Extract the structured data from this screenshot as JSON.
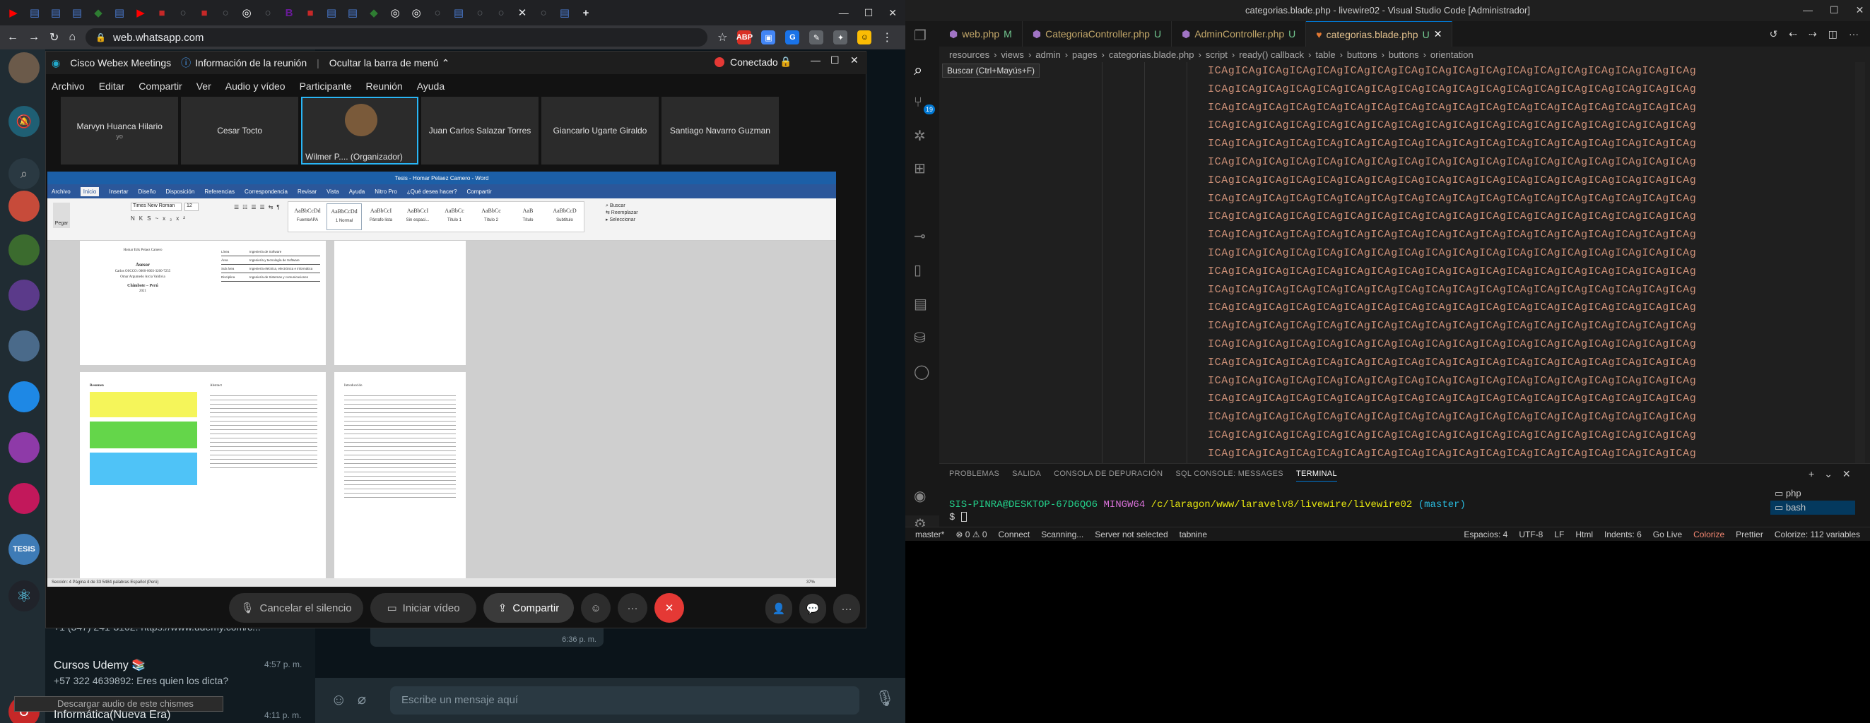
{
  "browser": {
    "url": "web.whatsapp.com",
    "tab_icons": [
      "youtube-icon",
      "page-icon",
      "page-icon",
      "page-icon",
      "green-icon",
      "page-icon",
      "youtube-icon",
      "red-icon",
      "circle-icon",
      "red-icon",
      "circle-icon",
      "github-icon",
      "circle-icon",
      "purple-icon",
      "red-icon",
      "page-icon",
      "page-icon",
      "green-icon",
      "github-icon",
      "github-icon",
      "circle-icon",
      "page-icon",
      "circle-icon",
      "circle-icon",
      "close-icon",
      "circle-icon",
      "page-icon",
      "add-icon"
    ]
  },
  "whatsapp": {
    "snippet_phone": "+1 (347) 241-3102: https://www.udemy.com/c...",
    "chat1_name": "Cursos Udemy 📚",
    "chat1_time": "4:57 p. m.",
    "chat1_msg": "+57 322 4639892: Eres quien los dicta?",
    "chat2_name": "Informática(Nueva Era)",
    "chat2_time": "4:11 p. m.",
    "download_toast": "Descargar audio de este chismes",
    "bubble_time": "6:36 p. m.",
    "composer_placeholder": "Escribe un mensaje aquí"
  },
  "webex": {
    "title": "Cisco Webex Meetings",
    "info": "Información de la reunión",
    "hide_menu": "Ocultar la barra de menú",
    "status": "Conectado",
    "menu": [
      "Archivo",
      "Editar",
      "Compartir",
      "Ver",
      "Audio y vídeo",
      "Participante",
      "Reunión",
      "Ayuda"
    ],
    "participants": [
      "Marvyn Huanca Hilario",
      "Cesar Tocto",
      "Wilmer P.... (Organizador)",
      "Juan Carlos Salazar Torres",
      "Giancarlo Ugarte Giraldo",
      "Santiago Navarro Guzman"
    ],
    "participant_sub": "yo",
    "mute": "Cancelar el silencio",
    "video": "Iniciar vídeo",
    "share": "Compartir",
    "word": {
      "title": "Tesis - Homar Pelaez Camero  -  Word",
      "tabs": [
        "Archivo",
        "Inicio",
        "Insertar",
        "Diseño",
        "Disposición",
        "Referencias",
        "Correspondencia",
        "Revisar",
        "Vista",
        "Ayuda",
        "Nitro Pro",
        "¿Qué desea hacer?",
        "Compartir"
      ],
      "font": "Times New Roman",
      "size": "12",
      "styles": [
        "AaBbCcDd",
        "AaBbCcDd",
        "AaBbCcI",
        "AaBbCcI",
        "AaBbCc",
        "AaBbCc",
        "AaB",
        "AaBbCcD"
      ],
      "style_names": [
        "FuenteAPA",
        "1 Normal",
        "Párrafo lista",
        "Sin espaci...",
        "Título 1",
        "Título 2",
        "Título",
        "Subtítulo"
      ],
      "page1": [
        "Homar Erik Pelaez Camero",
        "Asesor",
        "Carlos OSCCO: 0000-0003-3200-7255",
        "Omar Argumedo Arcia Valdivia",
        "Chimbote – Perú",
        "2021"
      ],
      "table_rows": [
        "Línea",
        "Área",
        "Sub área",
        "Disciplina"
      ],
      "table_vals": [
        "Ingeniería de Software",
        "Ingeniería y tecnología de Software",
        "Ingeniería eléctrica, electrónica e informática",
        "Ingeniería de Sistemas y comunicaciones"
      ],
      "p4_title": "Resumen",
      "p5_title": "Abstract",
      "p6_title": "Introducción",
      "status": "Sección: 4    Página 4 de 33    5484 palabras    Español (Perú)",
      "zoom": "37%"
    }
  },
  "vscode": {
    "title": "categorias.blade.php - livewire02 - Visual Studio Code [Administrador]",
    "tabs": [
      {
        "name": "web.php",
        "flag": "M"
      },
      {
        "name": "CategoriaController.php",
        "flag": "U"
      },
      {
        "name": "AdminController.php",
        "flag": "U"
      },
      {
        "name": "categorias.blade.php",
        "flag": "U"
      }
    ],
    "breadcrumbs": [
      "resources",
      "views",
      "admin",
      "pages",
      "categorias.blade.php",
      "script",
      "ready() callback",
      "table",
      "buttons",
      "buttons",
      "orientation"
    ],
    "search_tooltip": "Buscar (Ctrl+Mayús+F)",
    "code_line": "ICAgICAgICAgICAgICAgICAgICAgICAgICAgICAgICAgICAgICAgICAgICAgICAgICAgICAg",
    "line_count": 22,
    "panel_tabs": [
      "PROBLEMAS",
      "SALIDA",
      "CONSOLA DE DEPURACIÓN",
      "SQL CONSOLE: MESSAGES",
      "TERMINAL"
    ],
    "terminal_user": "SIS-PINRA@DESKTOP-67D6QO6",
    "terminal_shell": "MINGW64",
    "terminal_path": "/c/laragon/www/laravelv8/livewire/livewire02",
    "terminal_branch": "(master)",
    "prompt": "$",
    "terminal_items": [
      "php",
      "bash"
    ],
    "status_left": [
      "master*",
      "⊗ 0 ⚠ 0",
      "Connect",
      "Scanning...",
      "Server not selected",
      "tabnine"
    ],
    "status_right": [
      "Espacios: 4",
      "UTF-8",
      "LF",
      "Html",
      "Indents: 6",
      "Go Live",
      "Colorize",
      "Prettier",
      "Colorize: 112 variables"
    ]
  }
}
